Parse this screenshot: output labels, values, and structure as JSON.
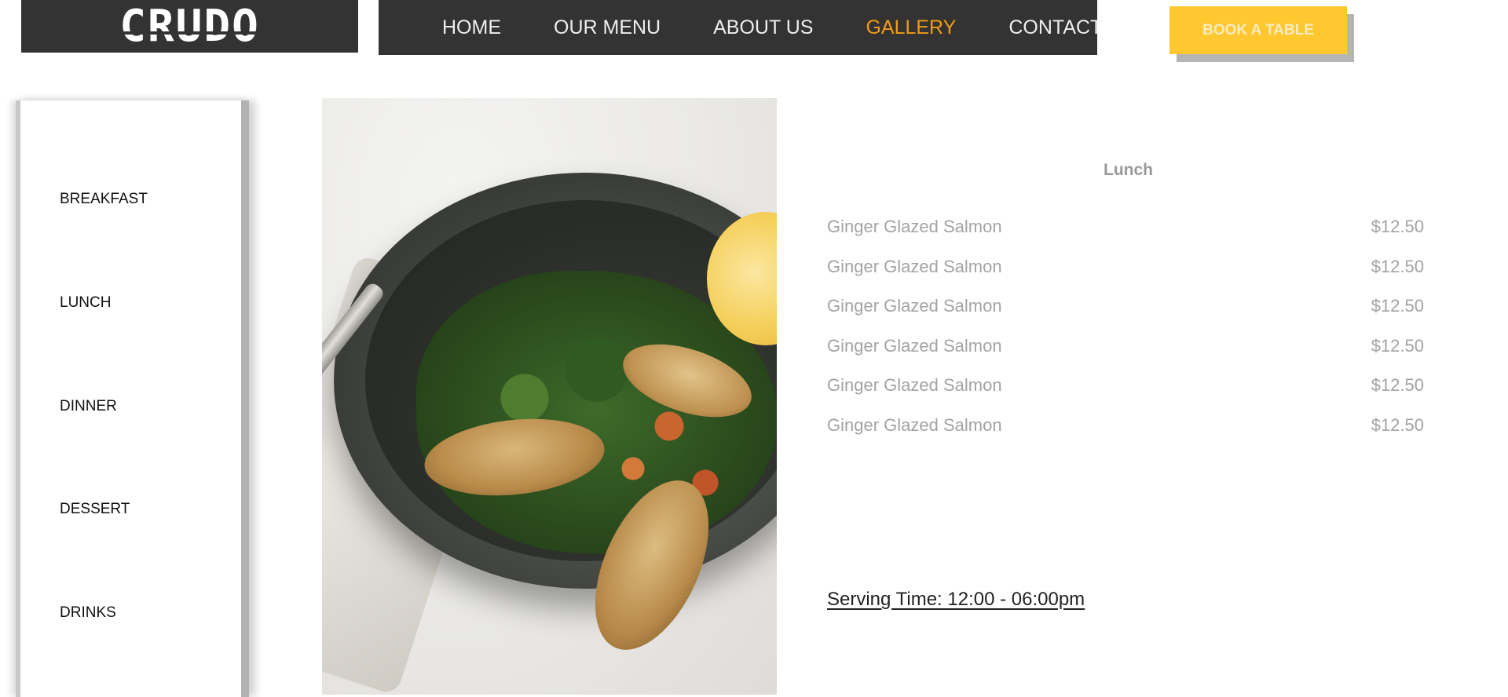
{
  "brand": {
    "logo_text": "CRUDO"
  },
  "nav": {
    "items": [
      {
        "label": "HOME",
        "active": false
      },
      {
        "label": "OUR MENU",
        "active": false
      },
      {
        "label": "ABOUT US",
        "active": false
      },
      {
        "label": "GALLERY",
        "active": true
      },
      {
        "label": "CONTACT",
        "active": false
      }
    ],
    "active_color": "#f39c12",
    "bar_color": "#333333"
  },
  "cta": {
    "book_label": "BOOK A TABLE",
    "color": "#ffc830"
  },
  "sidebar": {
    "items": [
      {
        "label": "BREAKFAST"
      },
      {
        "label": "LUNCH"
      },
      {
        "label": "DINNER"
      },
      {
        "label": "DESSERT"
      },
      {
        "label": "DRINKS"
      }
    ]
  },
  "photo": {
    "subject": "food-bowl-photo"
  },
  "menu": {
    "heading": "Lunch",
    "items": [
      {
        "name": "Ginger Glazed Salmon",
        "price": "$12.50"
      },
      {
        "name": "Ginger Glazed Salmon",
        "price": "$12.50"
      },
      {
        "name": "Ginger Glazed Salmon",
        "price": "$12.50"
      },
      {
        "name": "Ginger Glazed Salmon",
        "price": "$12.50"
      },
      {
        "name": "Ginger Glazed Salmon",
        "price": "$12.50"
      },
      {
        "name": "Ginger Glazed Salmon",
        "price": "$12.50"
      }
    ],
    "serving_time": "Serving Time: 12:00 - 06:00pm"
  }
}
